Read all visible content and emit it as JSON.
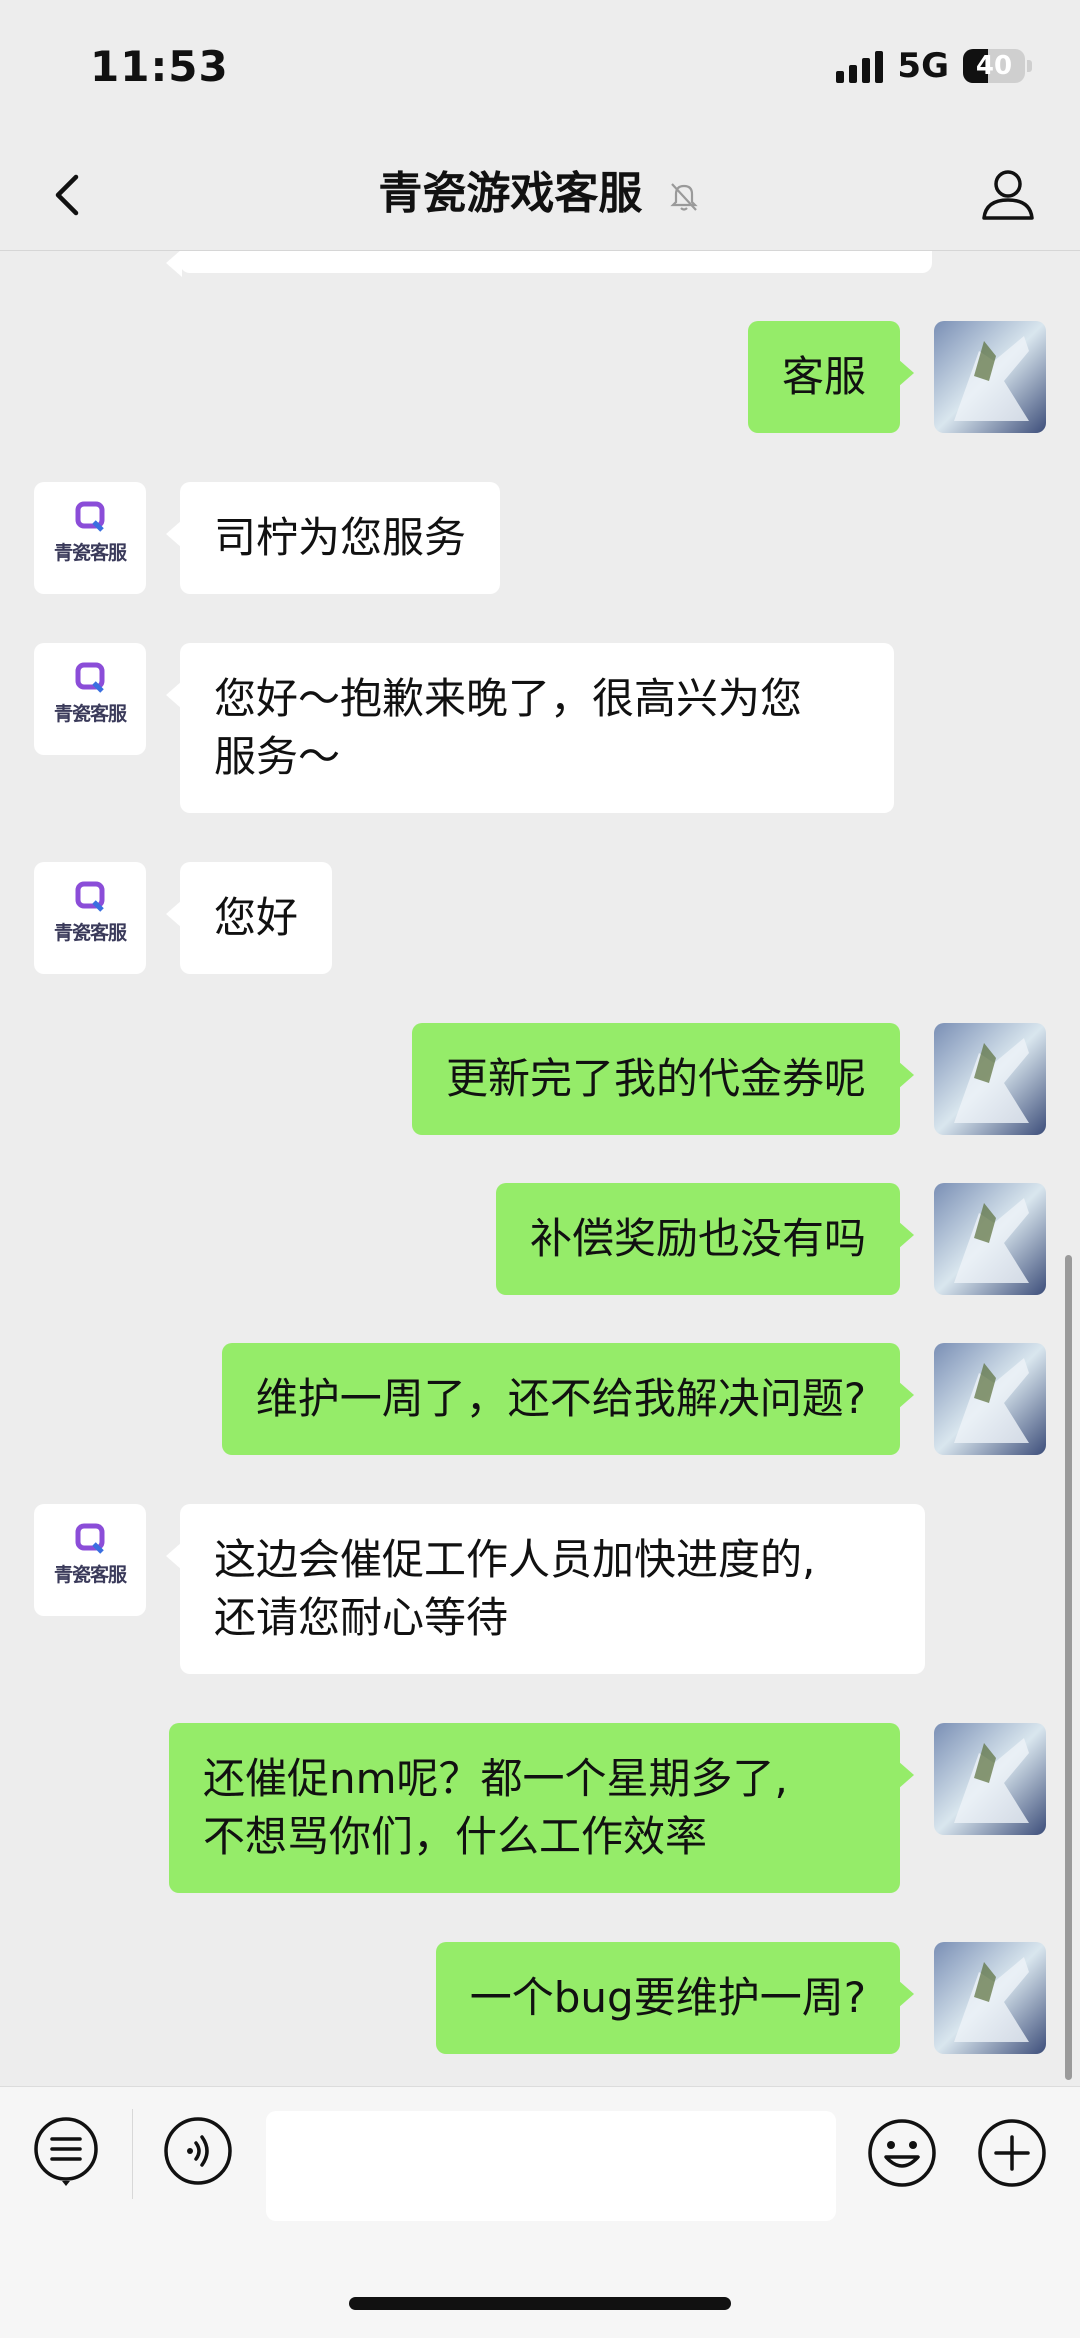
{
  "status_bar": {
    "time": "11:53",
    "network": "5G",
    "battery": "40"
  },
  "nav": {
    "title": "青瓷游戏客服"
  },
  "cs_avatar_label": "青瓷客服",
  "messages": [
    {
      "from": "me",
      "text": "客服"
    },
    {
      "from": "cs",
      "text": "司柠为您服务"
    },
    {
      "from": "cs",
      "line1": "您好～抱歉来晚了，很高兴为您",
      "line2": "服务～"
    },
    {
      "from": "cs",
      "text": "您好"
    },
    {
      "from": "me",
      "text": "更新完了我的代金券呢"
    },
    {
      "from": "me",
      "text": "补偿奖励也没有吗"
    },
    {
      "from": "me",
      "text": "维护一周了，还不给我解决问题?"
    },
    {
      "from": "cs",
      "line1": "这边会催促工作人员加快进度的,",
      "line2": "还请您耐心等待"
    },
    {
      "from": "me",
      "line1": "还催促nm呢？都一个星期多了,",
      "line2": "不想骂你们，什么工作效率"
    },
    {
      "from": "me",
      "text": "一个bug要维护一周?"
    }
  ],
  "icons": {
    "back": "chevron-left-icon",
    "mute": "bell-off-icon",
    "profile": "person-icon",
    "menu": "list-icon",
    "voice": "voice-icon",
    "emoji": "smile-icon",
    "plus": "plus-icon"
  }
}
